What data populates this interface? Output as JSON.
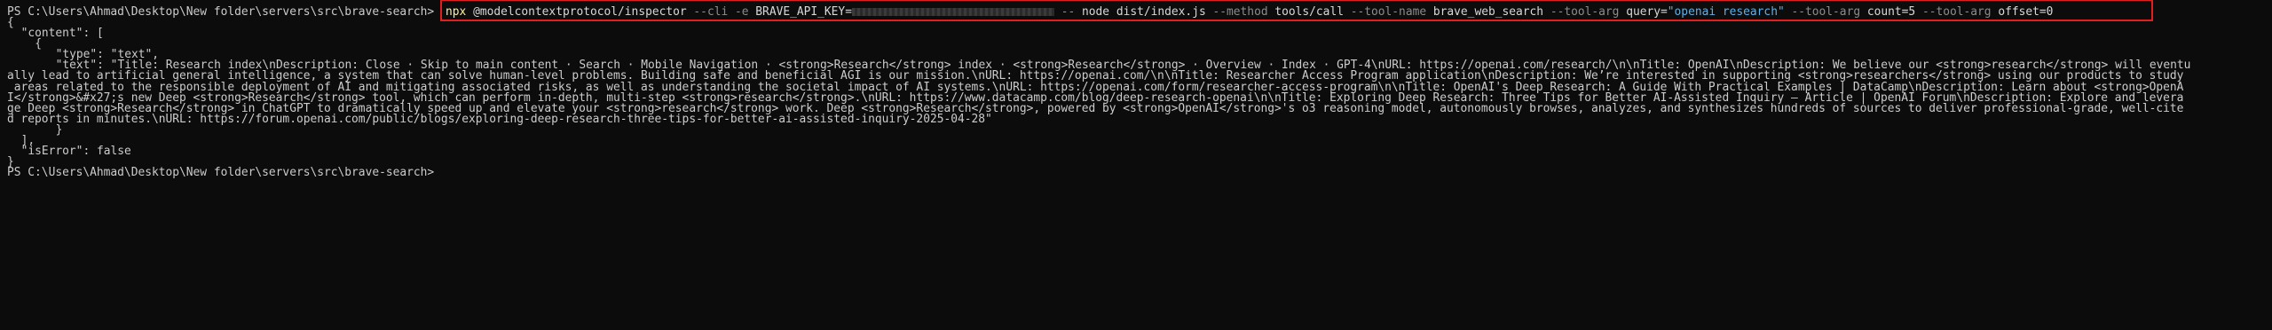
{
  "terminal": {
    "prompt": "PS C:\\Users\\Ahmad\\Desktop\\New folder\\servers\\src\\brave-search>",
    "command": {
      "exe": "npx",
      "package": "@modelcontextprotocol/inspector",
      "flag_cli": "--cli",
      "flag_e": "-e",
      "env_prefix": "BRAVE_API_KEY=",
      "sep": "--",
      "node": "node",
      "script": "dist/index.js",
      "flag_method": "--method",
      "method_value": "tools/call",
      "flag_tool_name": "--tool-name",
      "tool_name_value": "brave_web_search",
      "flag_tool_arg_1": "--tool-arg",
      "tool_arg_1_value_prefix": "query=",
      "tool_arg_1_value_string": "\"openai research\"",
      "flag_tool_arg_2": "--tool-arg",
      "tool_arg_2_value": "count=5",
      "flag_tool_arg_3": "--tool-arg",
      "tool_arg_3_value": "offset=0"
    },
    "output_lines": [
      "{",
      "\"content\": [",
      "{",
      "\"type\": \"text\",",
      "\"text\": \"Title: Research index\\nDescription: Close · Skip to main content · Search · Mobile Navigation · <strong>Research</strong> index · <strong>Research</strong> · Overview · Index · GPT-4\\nURL: https://openai.com/research/\\n\\nTitle: OpenAI\\nDescription: We believe our <strong>research</strong> will eventu",
      "ally lead to artificial general intelligence, a system that can solve human-level problems. Building safe and beneficial AGI is our mission.\\nURL: https://openai.com/\\n\\nTitle: Researcher Access Program application\\nDescription: We’re interested in supporting <strong>researchers</strong> using our products to study",
      " areas related to the responsible deployment of AI and mitigating associated risks, as well as understanding the societal impact of AI systems.\\nURL: https://openai.com/form/researcher-access-program\\n\\nTitle: OpenAI's Deep Research: A Guide With Practical Examples | DataCamp\\nDescription: Learn about <strong>OpenA",
      "I</strong>&#x27;s new Deep <strong>Research</strong> tool, which can perform in-depth, multi-step <strong>research</strong>.\\nURL: https://www.datacamp.com/blog/deep-research-openai\\n\\nTitle: Exploring Deep Research: Three Tips for Better AI-Assisted Inquiry – Article | OpenAI Forum\\nDescription: Explore and levera",
      "ge Deep <strong>Research</strong> in ChatGPT to dramatically speed up and elevate your <strong>research</strong> work. Deep <strong>Research</strong>, powered by <strong>OpenAI</strong>'s o3 reasoning model, autonomously browses, analyzes, and synthesizes hundreds of sources to deliver professional-grade, well-cite",
      "d reports in minutes.\\nURL: https://forum.openai.com/public/blogs/exploring-deep-research-three-tips-for-better-ai-assisted-inquiry-2025-04-28\"",
      "}",
      "],",
      "\"isError\": false",
      "}"
    ],
    "final_prompt": "PS C:\\Users\\Ahmad\\Desktop\\New folder\\servers\\src\\brave-search>"
  },
  "colors": {
    "background": "#0c0c0c",
    "text": "#cccccc",
    "exe": "#f9f1a5",
    "param": "#8c8c8c",
    "string": "#5fb0e6",
    "highlight_box": "#e02020"
  }
}
